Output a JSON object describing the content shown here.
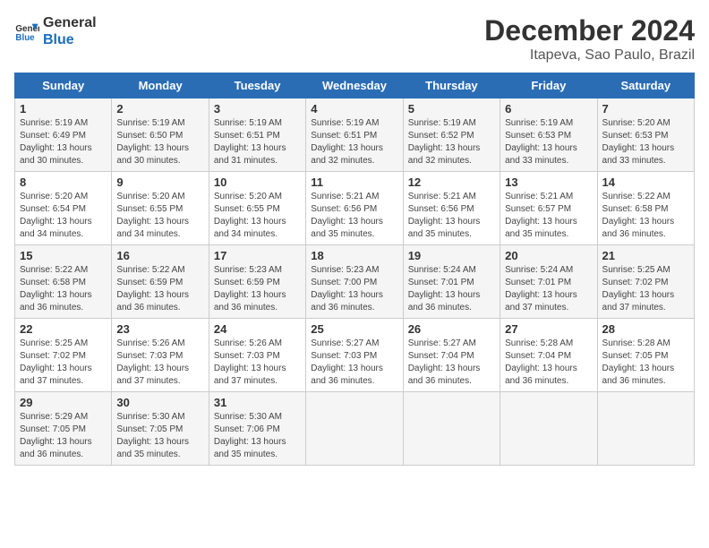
{
  "logo": {
    "line1": "General",
    "line2": "Blue"
  },
  "title": "December 2024",
  "subtitle": "Itapeva, Sao Paulo, Brazil",
  "days_of_week": [
    "Sunday",
    "Monday",
    "Tuesday",
    "Wednesday",
    "Thursday",
    "Friday",
    "Saturday"
  ],
  "weeks": [
    [
      {
        "day": "1",
        "info": "Sunrise: 5:19 AM\nSunset: 6:49 PM\nDaylight: 13 hours\nand 30 minutes."
      },
      {
        "day": "2",
        "info": "Sunrise: 5:19 AM\nSunset: 6:50 PM\nDaylight: 13 hours\nand 30 minutes."
      },
      {
        "day": "3",
        "info": "Sunrise: 5:19 AM\nSunset: 6:51 PM\nDaylight: 13 hours\nand 31 minutes."
      },
      {
        "day": "4",
        "info": "Sunrise: 5:19 AM\nSunset: 6:51 PM\nDaylight: 13 hours\nand 32 minutes."
      },
      {
        "day": "5",
        "info": "Sunrise: 5:19 AM\nSunset: 6:52 PM\nDaylight: 13 hours\nand 32 minutes."
      },
      {
        "day": "6",
        "info": "Sunrise: 5:19 AM\nSunset: 6:53 PM\nDaylight: 13 hours\nand 33 minutes."
      },
      {
        "day": "7",
        "info": "Sunrise: 5:20 AM\nSunset: 6:53 PM\nDaylight: 13 hours\nand 33 minutes."
      }
    ],
    [
      {
        "day": "8",
        "info": "Sunrise: 5:20 AM\nSunset: 6:54 PM\nDaylight: 13 hours\nand 34 minutes."
      },
      {
        "day": "9",
        "info": "Sunrise: 5:20 AM\nSunset: 6:55 PM\nDaylight: 13 hours\nand 34 minutes."
      },
      {
        "day": "10",
        "info": "Sunrise: 5:20 AM\nSunset: 6:55 PM\nDaylight: 13 hours\nand 34 minutes."
      },
      {
        "day": "11",
        "info": "Sunrise: 5:21 AM\nSunset: 6:56 PM\nDaylight: 13 hours\nand 35 minutes."
      },
      {
        "day": "12",
        "info": "Sunrise: 5:21 AM\nSunset: 6:56 PM\nDaylight: 13 hours\nand 35 minutes."
      },
      {
        "day": "13",
        "info": "Sunrise: 5:21 AM\nSunset: 6:57 PM\nDaylight: 13 hours\nand 35 minutes."
      },
      {
        "day": "14",
        "info": "Sunrise: 5:22 AM\nSunset: 6:58 PM\nDaylight: 13 hours\nand 36 minutes."
      }
    ],
    [
      {
        "day": "15",
        "info": "Sunrise: 5:22 AM\nSunset: 6:58 PM\nDaylight: 13 hours\nand 36 minutes."
      },
      {
        "day": "16",
        "info": "Sunrise: 5:22 AM\nSunset: 6:59 PM\nDaylight: 13 hours\nand 36 minutes."
      },
      {
        "day": "17",
        "info": "Sunrise: 5:23 AM\nSunset: 6:59 PM\nDaylight: 13 hours\nand 36 minutes."
      },
      {
        "day": "18",
        "info": "Sunrise: 5:23 AM\nSunset: 7:00 PM\nDaylight: 13 hours\nand 36 minutes."
      },
      {
        "day": "19",
        "info": "Sunrise: 5:24 AM\nSunset: 7:01 PM\nDaylight: 13 hours\nand 36 minutes."
      },
      {
        "day": "20",
        "info": "Sunrise: 5:24 AM\nSunset: 7:01 PM\nDaylight: 13 hours\nand 37 minutes."
      },
      {
        "day": "21",
        "info": "Sunrise: 5:25 AM\nSunset: 7:02 PM\nDaylight: 13 hours\nand 37 minutes."
      }
    ],
    [
      {
        "day": "22",
        "info": "Sunrise: 5:25 AM\nSunset: 7:02 PM\nDaylight: 13 hours\nand 37 minutes."
      },
      {
        "day": "23",
        "info": "Sunrise: 5:26 AM\nSunset: 7:03 PM\nDaylight: 13 hours\nand 37 minutes."
      },
      {
        "day": "24",
        "info": "Sunrise: 5:26 AM\nSunset: 7:03 PM\nDaylight: 13 hours\nand 37 minutes."
      },
      {
        "day": "25",
        "info": "Sunrise: 5:27 AM\nSunset: 7:03 PM\nDaylight: 13 hours\nand 36 minutes."
      },
      {
        "day": "26",
        "info": "Sunrise: 5:27 AM\nSunset: 7:04 PM\nDaylight: 13 hours\nand 36 minutes."
      },
      {
        "day": "27",
        "info": "Sunrise: 5:28 AM\nSunset: 7:04 PM\nDaylight: 13 hours\nand 36 minutes."
      },
      {
        "day": "28",
        "info": "Sunrise: 5:28 AM\nSunset: 7:05 PM\nDaylight: 13 hours\nand 36 minutes."
      }
    ],
    [
      {
        "day": "29",
        "info": "Sunrise: 5:29 AM\nSunset: 7:05 PM\nDaylight: 13 hours\nand 36 minutes."
      },
      {
        "day": "30",
        "info": "Sunrise: 5:30 AM\nSunset: 7:05 PM\nDaylight: 13 hours\nand 35 minutes."
      },
      {
        "day": "31",
        "info": "Sunrise: 5:30 AM\nSunset: 7:06 PM\nDaylight: 13 hours\nand 35 minutes."
      },
      {
        "day": "",
        "info": ""
      },
      {
        "day": "",
        "info": ""
      },
      {
        "day": "",
        "info": ""
      },
      {
        "day": "",
        "info": ""
      }
    ]
  ]
}
